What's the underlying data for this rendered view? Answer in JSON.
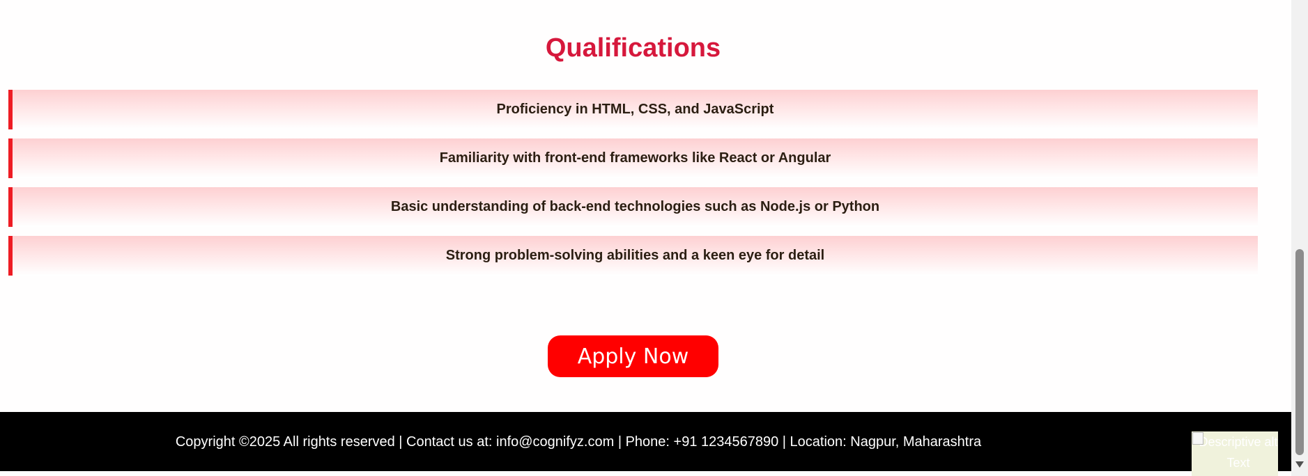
{
  "qualifications": {
    "title": "Qualifications",
    "items": [
      "Proficiency in HTML, CSS, and JavaScript",
      "Familiarity with front-end frameworks like React or Angular",
      "Basic understanding of back-end technologies such as Node.js or Python",
      "Strong problem-solving abilities and a keen eye for detail"
    ]
  },
  "apply_button": {
    "label": "Apply Now"
  },
  "footer": {
    "text": "Copyright ©2025 All rights reserved | Contact us at: info@cognifyz.com | Phone: +91 1234567890 | Location: Nagpur, Maharashtra"
  },
  "broken_image": {
    "alt": "Descriptive alt Text",
    "icon": "broken-image-icon"
  },
  "colors": {
    "heading": "#d6183c",
    "accent_border": "#ee1c24",
    "button": "#ff0000",
    "footer_bg": "#000000"
  }
}
